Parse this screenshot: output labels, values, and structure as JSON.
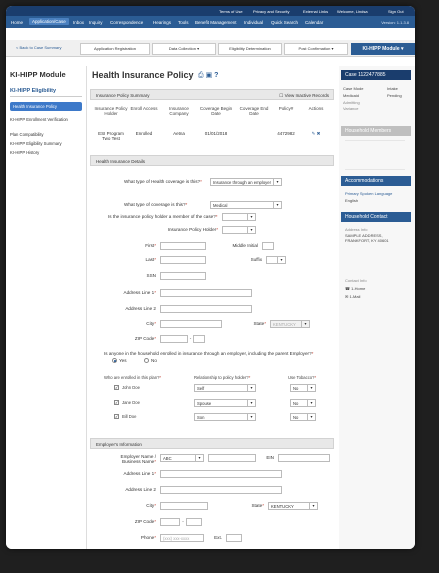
{
  "util_bar": [
    "Terms of Use",
    "Privacy and Security",
    "External Links",
    "Welcome, Lindsa",
    "Sign Out"
  ],
  "nav": {
    "items": [
      "Home",
      "Application/Case",
      "Inbox",
      "Inquiry",
      "Correspondence",
      "Hearings",
      "Tools",
      "Benefit Management",
      "Individual",
      "Quick Search",
      "Calendar"
    ],
    "active": "Application/Case",
    "version": "Version: 1.1.3.8"
  },
  "wizard": {
    "back": "< Back to Case Summary",
    "steps": [
      "Application Registration",
      "Data Collection",
      "Eligibility Determination",
      "Post Confirmation"
    ],
    "current": "KI-HIPP Module"
  },
  "sidebar": {
    "title": "KI-HIPP Module",
    "subtitle": "KI-HIPP Eligibility",
    "items": [
      "Health Insurance Policy",
      "KI-HIPP Enrollment Verification",
      "Plan Compatibility",
      "KI-HIPP Eligibility Summary",
      "KI-HIPP History"
    ]
  },
  "page": {
    "title": "Health Insurance Policy",
    "summary_head": "Insurance Policy Summary",
    "view_inactive": "View Inactive Records",
    "columns": [
      "Insurance Policy Holder",
      "Enroll Access",
      "Insurance Company",
      "Coverage Begin Date",
      "Coverage End Date",
      "Policy#",
      "Actions"
    ],
    "row": [
      "ESI Program Two Test",
      "Enrolled",
      "Aetna",
      "01/01/2018",
      "",
      "4472982"
    ],
    "details_head": "Health Insurance Details",
    "employer_head": "Employer's Information"
  },
  "details": {
    "q_coverage_where": "What type of Health coverage is this?",
    "v_coverage_where": "Insurance through an employer",
    "q_coverage_type": "What type of coverage is this?",
    "v_coverage_type": "Medical",
    "q_holder_member": "Is the insurance policy holder a member of the case?",
    "l_holder": "Insurance Policy Holder",
    "l_first": "First",
    "l_middle": "Middle Initial",
    "l_last": "Last",
    "l_suffix": "Suffix",
    "l_ssn": "SSN",
    "l_addr1": "Address Line 1",
    "l_addr2": "Address Line 2",
    "l_city": "City",
    "l_state": "State",
    "v_state": "KENTUCKY",
    "l_zip": "ZIP Code",
    "q_enrolled": "Is anyone in the household enrolled in insurance through an employer, including the parent Employer?",
    "r_yes": "Yes",
    "r_no": "No",
    "p_who": "Who are enrolled in this plan?",
    "p_rel": "Relationship to policy holder?",
    "p_tobacco": "Use Tobacco?",
    "people": [
      {
        "name": "John Doe",
        "rel": "Self",
        "tobacco": "No"
      },
      {
        "name": "Jane Doe",
        "rel": "Spouse",
        "tobacco": "No"
      },
      {
        "name": "Bill Doe",
        "rel": "Son",
        "tobacco": "No"
      }
    ]
  },
  "employer": {
    "l_name": "Employer Name / Business Name",
    "v_name": "ABC",
    "l_ein": "EIN",
    "l_addr1": "Address Line 1",
    "l_addr2": "Address Line 2",
    "l_city": "City",
    "l_state": "State",
    "v_state": "KENTUCKY",
    "l_zip": "ZIP Code",
    "l_phone": "Phone",
    "v_phone_placeholder": "(xxx) xxx-xxxx",
    "l_ext": "Ext."
  },
  "right": {
    "case_head": "Case",
    "case_no": "1122477885",
    "case_rows": [
      [
        "Case Mode",
        "Intake"
      ],
      [
        "Medicaid",
        "Pending"
      ],
      [
        "Admitting",
        ""
      ],
      [
        "Variance",
        ""
      ]
    ],
    "members_head": "Household Members",
    "accommodations_head": "Accommodations",
    "lang_label": "Primary Spoken Language",
    "lang_value": "English",
    "contact_head": "Household Contact",
    "addr_label": "Address Info",
    "addr_value": "SAMPLE ADDRESS, FRANKFORT, KY 40601",
    "contact_info": "Contact Info",
    "phone": "1-Home",
    "email": "1-Mail"
  }
}
